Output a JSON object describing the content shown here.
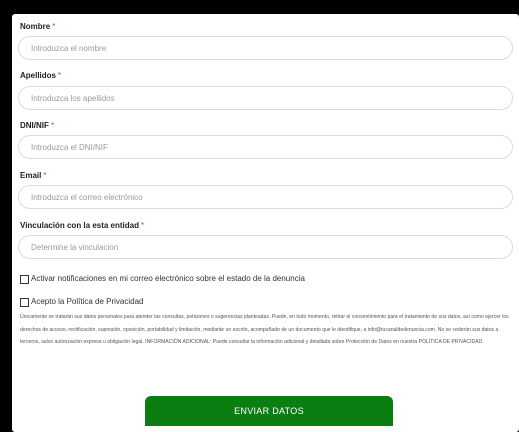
{
  "form": {
    "required_mark": "*",
    "fields": [
      {
        "label": "Nombre",
        "placeholder": "Introduzca el nombre"
      },
      {
        "label": "Apellidos",
        "placeholder": "Introduzca los apellidos"
      },
      {
        "label": "DNI/NIF",
        "placeholder": "Introduzca el DNI/NIF"
      },
      {
        "label": "Email",
        "placeholder": "Introduzca el correo electrónico"
      },
      {
        "label": "Vinculación con la esta entidad",
        "placeholder": "Determine la vinculacion"
      }
    ],
    "notifications_checkbox": {
      "label": "Activar notificaciones en mi correo electrónico sobre el estado de la denuncia",
      "checked": false
    },
    "privacy_checkbox": {
      "label": "Acepto la Política de Privacidad",
      "checked": false
    },
    "legal_text": "Únicamente se tratarán sus datos personales para atender las consultas, peticiones o sugerencias planteadas. Puede, en todo momento, retirar el consentimiento para el tratamiento de sus datos, así como ejercer los derechos de acceso, rectificación, supresión, oposición, portabilidad y limitación, mediante un escrito, acompañado de un documento que le identifique, a info@tucanaldedenuncia.com. No se cederán sus datos a terceros, salvo autorización expresa u obligación legal. INFORMACIÓN ADICIONAL: Puede consultar la información adicional y detallada sobre Protección de Datos en nuestra POLÍTICA DE PRIVACIDAD.",
    "submit_label": "ENVIAR DATOS"
  },
  "colors": {
    "button": "#0b7e12",
    "required_mark": "#d64545",
    "frame": "#000000"
  }
}
